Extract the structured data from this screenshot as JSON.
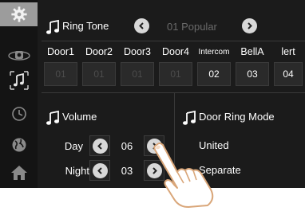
{
  "sidebar": {
    "items": [
      {
        "icon": "gear-icon",
        "active": true
      },
      {
        "icon": "camera-icon",
        "active": false
      },
      {
        "icon": "music-note-icon",
        "active": false
      },
      {
        "icon": "clock-icon",
        "active": false
      },
      {
        "icon": "globe-icon",
        "active": false
      },
      {
        "icon": "home-icon",
        "active": false
      }
    ]
  },
  "ring_tone": {
    "label": "Ring Tone",
    "current": "01 Popular"
  },
  "doors": [
    {
      "name": "Door1",
      "value": "01",
      "active": false
    },
    {
      "name": "Door2",
      "value": "01",
      "active": false
    },
    {
      "name": "Door3",
      "value": "01",
      "active": false
    },
    {
      "name": "Door4",
      "value": "01",
      "active": false
    },
    {
      "name": "Intercom",
      "value": "02",
      "active": true
    },
    {
      "name": "BellA",
      "value": "03",
      "active": true
    },
    {
      "name": "lert",
      "value": "04",
      "active": true
    }
  ],
  "volume": {
    "label": "Volume",
    "day_label": "Day",
    "day_value": "06",
    "night_label": "Night",
    "night_value": "03"
  },
  "door_ring_mode": {
    "label": "Door Ring Mode",
    "options": [
      "United",
      "Separate"
    ]
  },
  "colors": {
    "background": "#1b1b1b",
    "sidebar": "#141414",
    "active_sidebar": "#9c9c9c",
    "button": "#d8d8d8",
    "dim_text": "#4c4c4c"
  }
}
